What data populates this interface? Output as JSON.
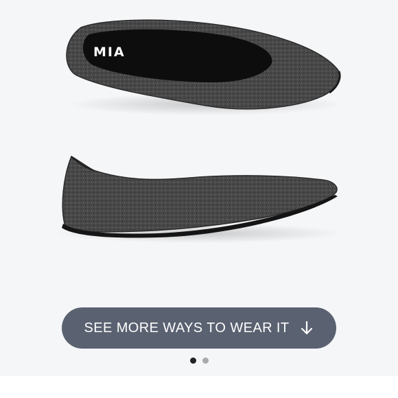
{
  "product": {
    "brand_label": "MIA",
    "image_name": "product-image-dark-grey-knit-flats",
    "colors": {
      "background": "#f5f6f8",
      "knit": "#4a4a4a",
      "insole": "#0d0d0d",
      "sole": "#151515"
    }
  },
  "cta": {
    "label": "SEE MORE WAYS TO WEAR IT",
    "icon": "arrow-down-icon",
    "color": "#5a6170"
  },
  "carousel": {
    "total": 2,
    "active_index": 0
  }
}
